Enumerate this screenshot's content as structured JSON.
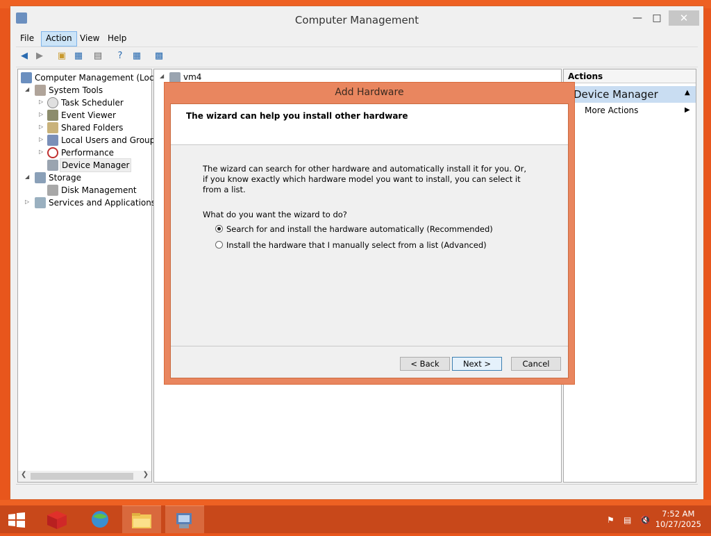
{
  "window": {
    "title": "Computer Management",
    "controls": {
      "minimize": "—",
      "maximize": "□",
      "close": "✕"
    }
  },
  "menu": [
    {
      "label": "File"
    },
    {
      "label": "Action",
      "active": true
    },
    {
      "label": "View"
    },
    {
      "label": "Help"
    }
  ],
  "tree": {
    "root": "Computer Management (Local",
    "items": [
      {
        "label": "System Tools"
      },
      {
        "label": "Task Scheduler"
      },
      {
        "label": "Event Viewer"
      },
      {
        "label": "Shared Folders"
      },
      {
        "label": "Local Users and Groups"
      },
      {
        "label": "Performance"
      },
      {
        "label": "Device Manager"
      },
      {
        "label": "Storage"
      },
      {
        "label": "Disk Management"
      },
      {
        "label": "Services and Applications"
      }
    ]
  },
  "center": {
    "node": "vm4"
  },
  "actions": {
    "header": "Actions",
    "section": "Device Manager",
    "more": "More Actions"
  },
  "dialog": {
    "title": "Add Hardware",
    "heading": "The wizard can help you install other hardware",
    "description": "The wizard can search for other hardware and automatically install it for you. Or, if you know exactly which hardware model you want to install, you can select it from a list.",
    "question": "What do you want the wizard to do?",
    "options": [
      {
        "label": "Search for and install the hardware automatically (Recommended)",
        "selected": true
      },
      {
        "label": "Install the hardware that I manually select from a list (Advanced)",
        "selected": false
      }
    ],
    "buttons": {
      "back": "< Back",
      "next": "Next >",
      "cancel": "Cancel"
    }
  },
  "taskbar": {
    "time": "7:52 AM",
    "date": "10/27/2025"
  },
  "colors": {
    "desktop": "#e8561c",
    "dialog_frame": "#e9865f",
    "selection": "#c9ddf2"
  }
}
